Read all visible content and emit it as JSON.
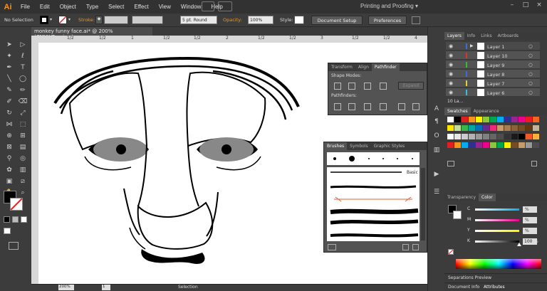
{
  "app": {
    "logo": "Ai",
    "menus": [
      "File",
      "Edit",
      "Object",
      "Type",
      "Select",
      "Effect",
      "View",
      "Window",
      "Help"
    ],
    "workspace": "Printing and Proofing",
    "workspace_arrow": "▾"
  },
  "control": {
    "selection": "No Selection",
    "stroke_label": "Stroke:",
    "stroke_field": "◆",
    "brush": "5 pt. Round",
    "opacity_label": "Opacity:",
    "opacity_value": "100%",
    "style_label": "Style:",
    "document_setup": "Document Setup",
    "preferences": "Preferences"
  },
  "document": {
    "tab": "monkey funny face.ai* @ 200% (CMYK/Preview)",
    "close": "×"
  },
  "ruler": {
    "top_ticks": [
      "1/2",
      "1/2",
      "1",
      "1/2",
      "1/2",
      "2",
      "1/2",
      "1/2",
      "3",
      "1/2",
      "1/2",
      "4"
    ]
  },
  "statusbar": {
    "zoom": "200%",
    "page": "1",
    "mode": "Selection"
  },
  "pathfinder": {
    "tabs": [
      "Transform",
      "Align",
      "Pathfinder"
    ],
    "shape_modes": "Shape Modes:",
    "pathfinders": "Pathfinders:",
    "expand": "Expand"
  },
  "brushes": {
    "tabs": [
      "Brushes",
      "Symbols",
      "Graphic Styles"
    ],
    "basic": "Basic"
  },
  "layers": {
    "tabs": [
      "Layers",
      "Info",
      "Links",
      "Artboards"
    ],
    "rows": [
      "Layer 1",
      "Layer 10",
      "Layer 9",
      "Layer 8",
      "Layer 7",
      "Layer 6"
    ],
    "count": "10 La..."
  },
  "swatches": {
    "tabs": [
      "Swatches",
      "Appearance"
    ]
  },
  "color": {
    "tabs": [
      "Transparency",
      "Color"
    ],
    "channels": [
      {
        "name": "C",
        "value": ""
      },
      {
        "name": "M",
        "value": ""
      },
      {
        "name": "Y",
        "value": ""
      },
      {
        "name": "K",
        "value": "100"
      }
    ],
    "k_level": 1.0
  },
  "bottom": {
    "separations": "Separations Preview",
    "document_info": "Document Info",
    "attributes": "Attributes"
  },
  "colors": {
    "accent": "#f7941d",
    "canvas": "#ffffff",
    "eye_gray": "#888888"
  }
}
